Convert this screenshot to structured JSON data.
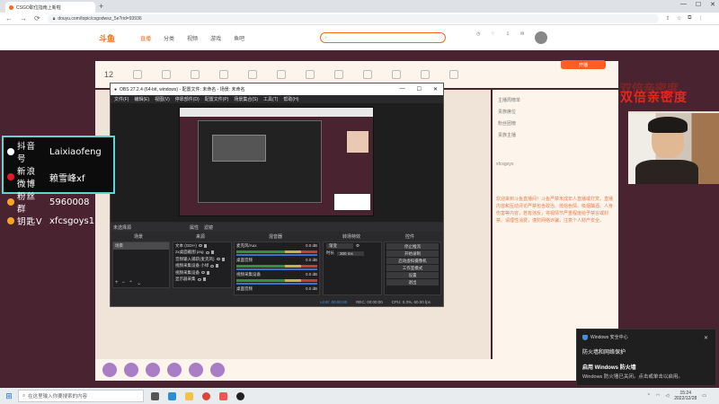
{
  "browser": {
    "tab_title": "CSGO职位指南上新啦",
    "new_tab": "+",
    "url": "douyu.com/topic/csgodwsz_5e?rid=93936",
    "window_controls": [
      "—",
      "☐",
      "✕"
    ]
  },
  "site": {
    "logo": "斗鱼",
    "nav_items": [
      "直播",
      "分类",
      "视频",
      "游戏",
      "鱼吧"
    ],
    "nav_active": "直播",
    "room_number": "12",
    "open_live_btn": "开播",
    "right_panel": {
      "rows": [
        "主播周榜单",
        "贵族席位",
        "粉丝团榜"
      ],
      "fan_label": "贵族主播",
      "chat_user": "xfcsgoys",
      "announcement": "欢迎来到斗鱼直播间！斗鱼严禁未成年人直播或打赏。直播内容和互动评论严禁包含政治、低俗色情、吸烟酗酒、人身伤害等内容，若有违反，将视情节严重程度给予禁言或封禁。请理性消费，谨防网络诈骗，注意个人财产安全。"
    },
    "promo_text": "双倍亲密度"
  },
  "obs": {
    "title": "OBS 27.2.4 (64-bit, windows) - 配置文件: 未命名 - 场景: 未命名",
    "menu": [
      "文件(F)",
      "编辑(E)",
      "视图(V)",
      "停靠部件(D)",
      "配置文件(P)",
      "场景集合(S)",
      "工具(T)",
      "帮助(H)"
    ],
    "ctrl_row": [
      "属性",
      "滤镜"
    ],
    "no_source": "未选择源",
    "dock_titles": {
      "scenes": "场景",
      "sources": "来源",
      "mixer": "混音器",
      "transitions": "转场特效",
      "controls": "控件"
    },
    "scenes": [
      "场景"
    ],
    "sources": [
      "文本 (GDI+)",
      "2x桌面截图 png",
      "音频输入捕获(麦克风)",
      "视频采集设备 小绿",
      "视频采集设备",
      "显示器采集"
    ],
    "mixer": [
      {
        "name": "麦克风/Aux",
        "db": "0.0 dB"
      },
      {
        "name": "桌面音频",
        "db": "0.0 dB"
      },
      {
        "name": "视频采集设备",
        "db": "0.0 dB"
      },
      {
        "name": "桌面音频",
        "db": "0.0 dB"
      }
    ],
    "transitions": {
      "type": "渐变",
      "duration_label": "时长",
      "duration": "300 ms"
    },
    "controls": [
      "停止推流",
      "开始录制",
      "启动虚拟摄像机",
      "工作室模式",
      "设置",
      "退出"
    ],
    "status": {
      "live": "LIVE: 00:00:00",
      "rec": "REC: 00:00:00",
      "cpu": "CPU: 0.3%, 60.00 fps"
    }
  },
  "social": [
    {
      "key": "抖音号",
      "value": "Laixiaofeng",
      "icon_color": "#ffffff"
    },
    {
      "key": "新浪微博",
      "value": "赖雪峰xf",
      "icon_color": "#e6162d"
    },
    {
      "key": "粉丝群",
      "value": "5960008",
      "icon_color": "#f5a623"
    },
    {
      "key": "钥匙V",
      "value": "xfcsgoys1",
      "icon_color": "#f5a623"
    }
  ],
  "toast": {
    "app": "Windows 安全中心",
    "line1": "防火墙和网络保护",
    "title": "启用 Windows 防火墙",
    "body": "Windows 防火墙已关闭。点击或单击以启用。"
  },
  "taskbar": {
    "search_placeholder": "在这里输入你要搜索的内容",
    "time": "15:24",
    "date": "2022/12/28"
  },
  "colors": {
    "accent": "#f26c1f",
    "obs_bg": "#2a2a2c",
    "promo": "#e8261a",
    "overlay_border": "#5fd4d4"
  }
}
